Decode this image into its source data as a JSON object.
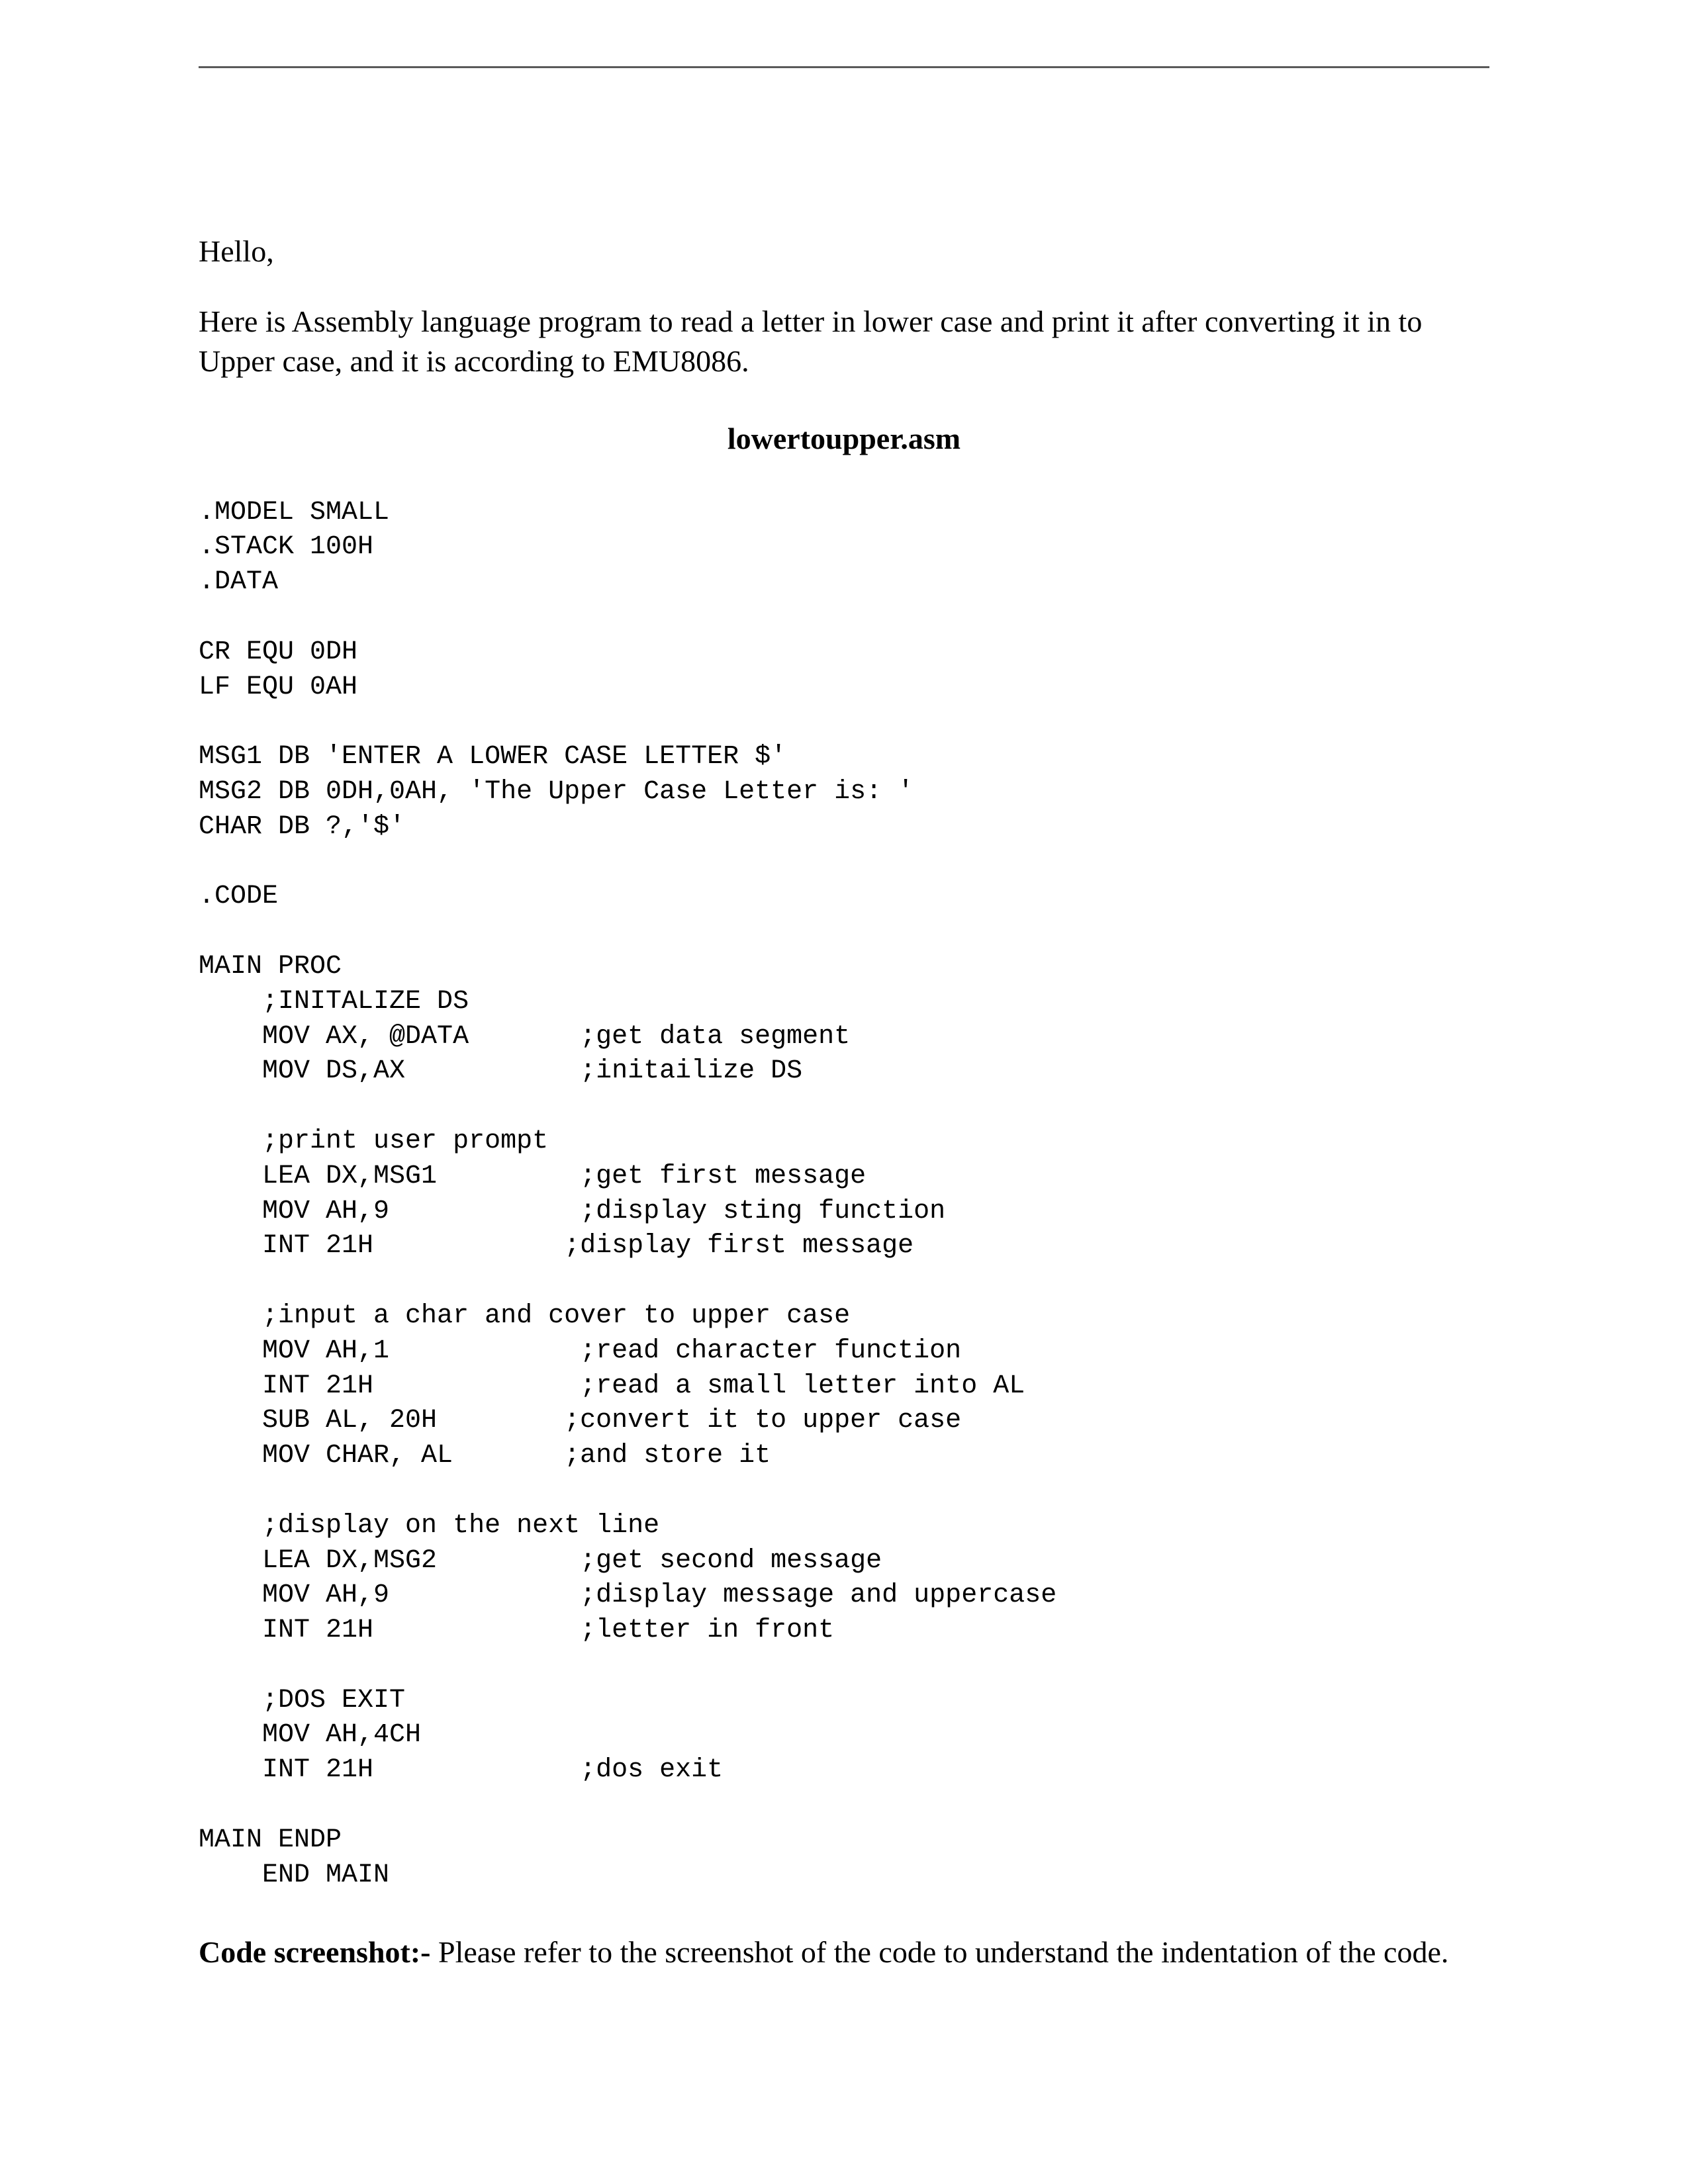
{
  "greeting": "Hello,",
  "intro": "Here is Assembly language program to read a letter in lower case and print it after converting it in to Upper case, and it is according to EMU8086.",
  "filename": "lowertoupper.asm",
  "code": ".MODEL SMALL\n.STACK 100H\n.DATA\n\nCR EQU 0DH\nLF EQU 0AH\n\nMSG1 DB 'ENTER A LOWER CASE LETTER $'\nMSG2 DB 0DH,0AH, 'The Upper Case Letter is: '\nCHAR DB ?,'$'\n\n.CODE\n\nMAIN PROC\n    ;INITALIZE DS\n    MOV AX, @DATA       ;get data segment\n    MOV DS,AX           ;initailize DS\n\n    ;print user prompt\n    LEA DX,MSG1         ;get first message\n    MOV AH,9            ;display sting function\n    INT 21H            ;display first message\n\n    ;input a char and cover to upper case\n    MOV AH,1            ;read character function\n    INT 21H             ;read a small letter into AL\n    SUB AL, 20H        ;convert it to upper case\n    MOV CHAR, AL       ;and store it\n\n    ;display on the next line\n    LEA DX,MSG2         ;get second message\n    MOV AH,9            ;display message and uppercase\n    INT 21H             ;letter in front\n\n    ;DOS EXIT\n    MOV AH,4CH\n    INT 21H             ;dos exit\n\nMAIN ENDP\n    END MAIN",
  "footer_bold": "Code screenshot:- ",
  "footer_rest": "Please refer to the screenshot of the code to understand the indentation of the code."
}
